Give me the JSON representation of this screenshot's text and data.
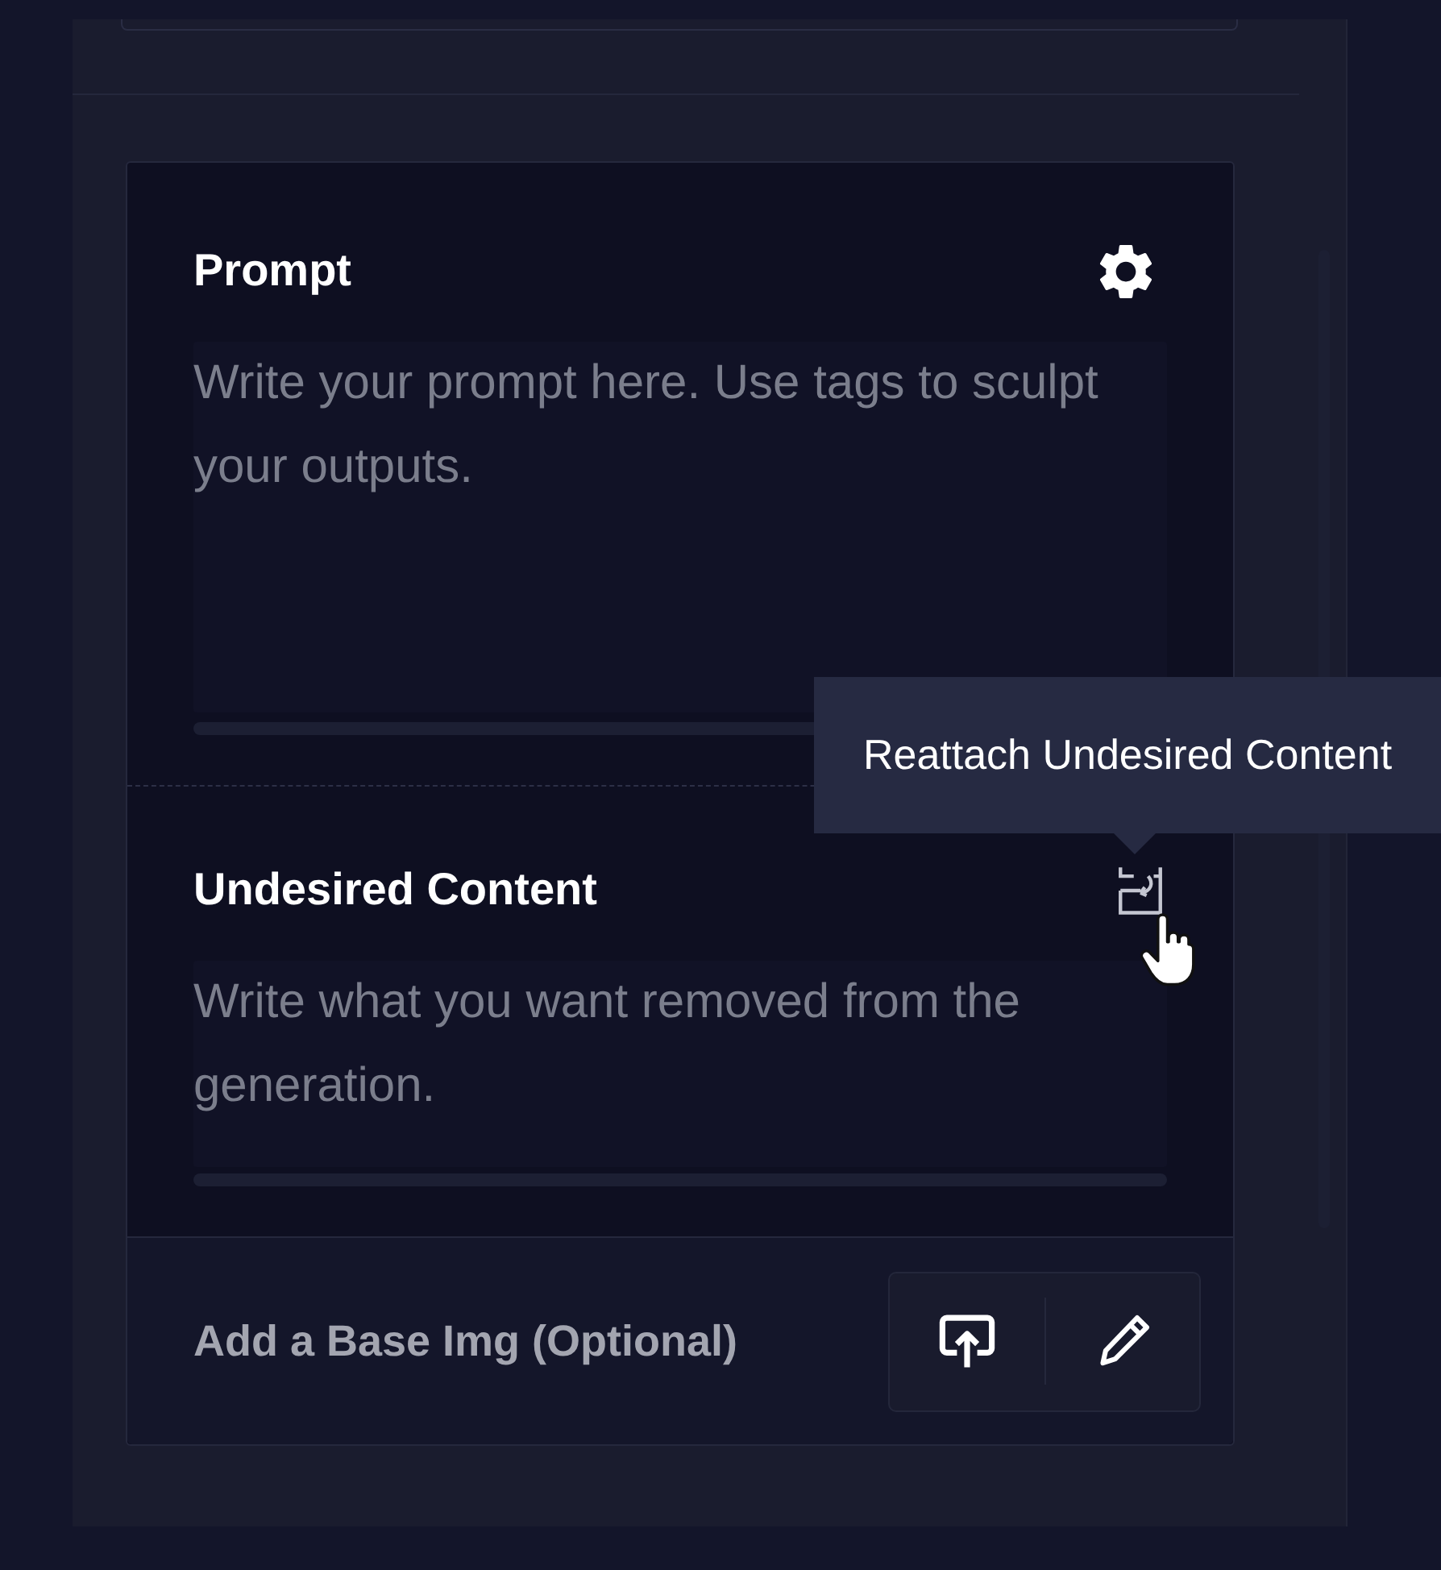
{
  "prompt": {
    "title": "Prompt",
    "placeholder": "Write your prompt here. Use tags to sculpt your outputs."
  },
  "undesired_content": {
    "title": "Undesired Content",
    "placeholder": "Write what you want removed from the generation."
  },
  "tooltip": {
    "text": "Reattach Undesired Content"
  },
  "base_image": {
    "label": "Add a Base Img (Optional)"
  }
}
